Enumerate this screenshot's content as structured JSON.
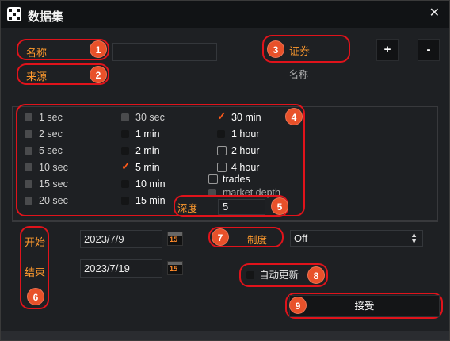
{
  "window": {
    "title": "数据集",
    "close_glyph": "✕"
  },
  "labels": {
    "name": "名称",
    "source": "来源",
    "security": "证券",
    "security_sub": "名称",
    "depth": "深度",
    "start": "开始",
    "end": "结束",
    "mode": "制度",
    "auto_update": "自动更新",
    "accept": "接受"
  },
  "buttons": {
    "add": "+",
    "remove": "-"
  },
  "inputs": {
    "name_value": "",
    "depth_value": "5",
    "start_date": "2023/7/9",
    "end_date": "2023/7/19",
    "mode_value": "Off",
    "calendar_day": "15"
  },
  "intervals": {
    "col1": [
      {
        "label": "1 sec",
        "checked": false
      },
      {
        "label": "2 sec",
        "checked": false
      },
      {
        "label": "5 sec",
        "checked": false
      },
      {
        "label": "10 sec",
        "checked": false
      },
      {
        "label": "15 sec",
        "checked": false
      },
      {
        "label": "20 sec",
        "checked": false
      }
    ],
    "col2": [
      {
        "label": "30 sec",
        "checked": false
      },
      {
        "label": "1 min",
        "checked": false
      },
      {
        "label": "2 min",
        "checked": false
      },
      {
        "label": "5 min",
        "checked": true
      },
      {
        "label": "10 min",
        "checked": false
      },
      {
        "label": "15 min",
        "checked": false
      }
    ],
    "col3": [
      {
        "label": "30 min",
        "checked": true
      },
      {
        "label": "1 hour",
        "checked": false
      },
      {
        "label": "2 hour",
        "checked": false
      },
      {
        "label": "4 hour",
        "checked": false
      }
    ],
    "trades": "trades",
    "market_depth": "market depth"
  },
  "badges": [
    "1",
    "2",
    "3",
    "4",
    "5",
    "6",
    "7",
    "8",
    "9"
  ],
  "colors": {
    "accent": "#ff9a2e",
    "annotation": "#e0131b",
    "badge": "#e8512a",
    "check": "#ff5a1a"
  }
}
